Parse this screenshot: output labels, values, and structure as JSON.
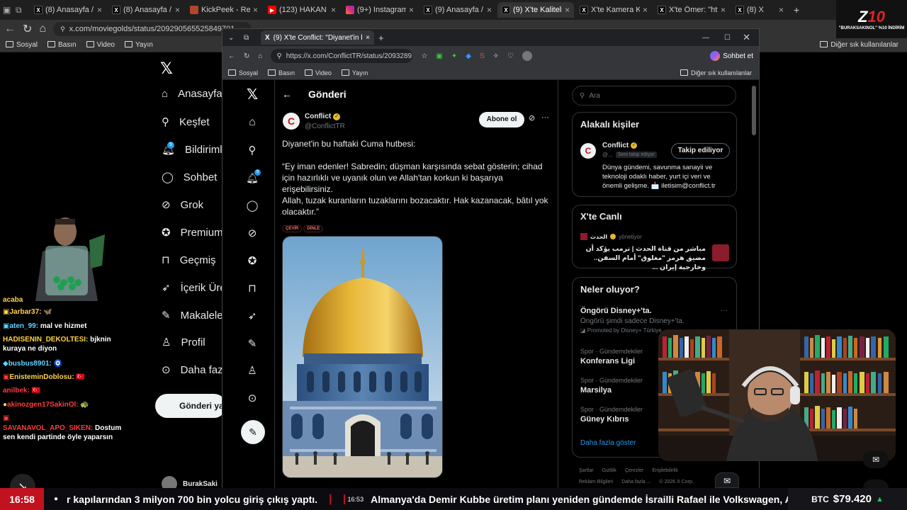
{
  "outer_browser": {
    "tabs": [
      {
        "label": "(8) Anasayfa / X",
        "icon": "x"
      },
      {
        "label": "(8) Anasayfa / X",
        "icon": "x"
      },
      {
        "label": "KickPeek - Real-time",
        "icon": "kick"
      },
      {
        "label": "(123) HAKAN FİDAN",
        "icon": "youtube"
      },
      {
        "label": "(9+) Instagram",
        "icon": "instagram"
      },
      {
        "label": "(9) Anasayfa / X",
        "icon": "x"
      },
      {
        "label": "(9) X'te Kaliteli İzlem",
        "icon": "x"
      },
      {
        "label": "X'te Kamera Kaydı",
        "icon": "x"
      },
      {
        "label": "X'te Ömer: \"https://",
        "icon": "x"
      },
      {
        "label": "(8) X",
        "icon": "x"
      }
    ],
    "url": "x.com/moviegolds/status/209290565525849701",
    "bookmarks": [
      "Sosyal",
      "Basın",
      "Video",
      "Yayın"
    ],
    "other_bookmarks": "Diğer sık kullanılanlar"
  },
  "logo": {
    "brand": "Z10",
    "promo": "\"BURAKSAKINOL\" %10 İNDİRİM"
  },
  "outer_nav": [
    "Anasayfa",
    "Keşfet",
    "Bildirimler",
    "Sohbet",
    "Grok",
    "Premium",
    "Geçmiş",
    "İçerik Üre",
    "Makaleler",
    "Profil",
    "Daha fazla"
  ],
  "outer_notif_badge": "9",
  "outer_post_button": "Gönderi yayınla",
  "outer_account": "BurakSaki",
  "chat": [
    {
      "user": "",
      "msg": "acaba",
      "color": "u-yel"
    },
    {
      "user": "Jarbar37:",
      "msg": "🦋",
      "color": "u-yel"
    },
    {
      "user": "aten_99:",
      "msg": "mal ve hizmet",
      "color": "u-cyan"
    },
    {
      "user": "HADISENIN_DEKOLTESI:",
      "msg": "bjknin kuraya ne diyon",
      "color": "u-yel"
    },
    {
      "user": "busbus8901:",
      "msg": "🧿",
      "color": "u-cyan"
    },
    {
      "user": "EnisteminDoblosu:",
      "msg": "🇹🇷",
      "color": "u-yel"
    },
    {
      "user": "anilbek:",
      "msg": "🇹🇷",
      "color": "u-red"
    },
    {
      "user": "akinozgen17SakinOl:",
      "msg": "🐢",
      "color": "u-red"
    },
    {
      "user": "SAVANAVOL_APO_SIKEN:",
      "msg": "Dostum sen kendi partinde öyle yaparsın",
      "color": "u-red"
    }
  ],
  "inner_browser": {
    "tab_label": "(9) X'te Conflict: \"Diyanet'in bu haf",
    "url": "https://x.com/ConflictTR/status/2093289...",
    "profile_button": "Sohbet et",
    "bookmarks": [
      "Sosyal",
      "Basın",
      "Video",
      "Yayın"
    ],
    "other_bookmarks": "Diğer sık kullanılanlar"
  },
  "inner_notif_badge": "9",
  "post": {
    "header": "Gönderi",
    "author_name": "Conflict",
    "author_handle": "@ConflictTR",
    "subscribe": "Abone ol",
    "text_1": "Diyanet'in bu haftaki Cuma hutbesi:",
    "text_2": "“Ey iman edenler! Sabredin; düşman karşısında sebat gösterin; cihad için hazırlıklı ve uyanık olun ve Allah'tan korkun ki başarıya erişebilirsiniz.",
    "text_3": "Allah, tuzak kuranların tuzaklarını bozacaktır. Hak kazanacak, bâtıl yok olacaktır.”",
    "pill_translate": "ÇEVİR",
    "pill_listen": "DİNLE"
  },
  "right": {
    "search_placeholder": "Ara",
    "related_title": "Alakalı kişiler",
    "related": {
      "name": "Conflict",
      "handle": "@...",
      "follows_you": "Seni takip ediyor",
      "follow_button": "Takip ediliyor",
      "bio": "Dünya gündemi, savunma sanayii ve teknoloji odaklı haber, yurt içi veri ve önemli gelişme. 📩 iletisim@conflict.tr"
    },
    "live_title": "X'te Canlı",
    "live": {
      "host": "الحدث",
      "status": "yönetiyor",
      "text": "مباشر من قناة الحدث | ترمب يؤكد أن مضيق هرمز \"مغلوق\" أمام السفن.. وخارجية إيران ..."
    },
    "trends_title": "Neler oluyor?",
    "promo": {
      "name": "Öngörü Disney+'ta.",
      "desc": "Öngörü şimdi sadece Disney+'ta.",
      "promoted": "Promoted by Disney+ Türkiye"
    },
    "trends": [
      {
        "cat": "Spor · Gündemdekiler",
        "name": "Konferans Ligi"
      },
      {
        "cat": "Spor · Gündemdekiler",
        "name": "Marsilya"
      },
      {
        "cat": "Spor · Gündemdekiler",
        "name": "Güney Kıbrıs"
      }
    ],
    "show_more": "Daha fazla göster",
    "footer_row1": [
      "Şartlar",
      "Gizlilik",
      "Çerezler",
      "Erişilebilirlik"
    ],
    "footer_row2": [
      "Reklam Bilgileri",
      "Daha fazla ...",
      "© 2026 X Corp."
    ]
  },
  "ticker": {
    "time": "16:58",
    "item1": "r kapılarından 3 milyon 700 bin yolcu giriş çıkış yaptı.",
    "item2_time": "16:53",
    "item2": "Almanya'da Demir Kubbe üretim planı yeniden gündemde İsrailli Rafael ile Volkswagen, Alma",
    "btc_label": "BTC",
    "btc_value": "$79.420"
  },
  "colors": {
    "x_blue": "#1d9bf0",
    "ticker_red": "#c1121f",
    "verified_gold": "#e8b829",
    "btc_green": "#22c55e"
  }
}
